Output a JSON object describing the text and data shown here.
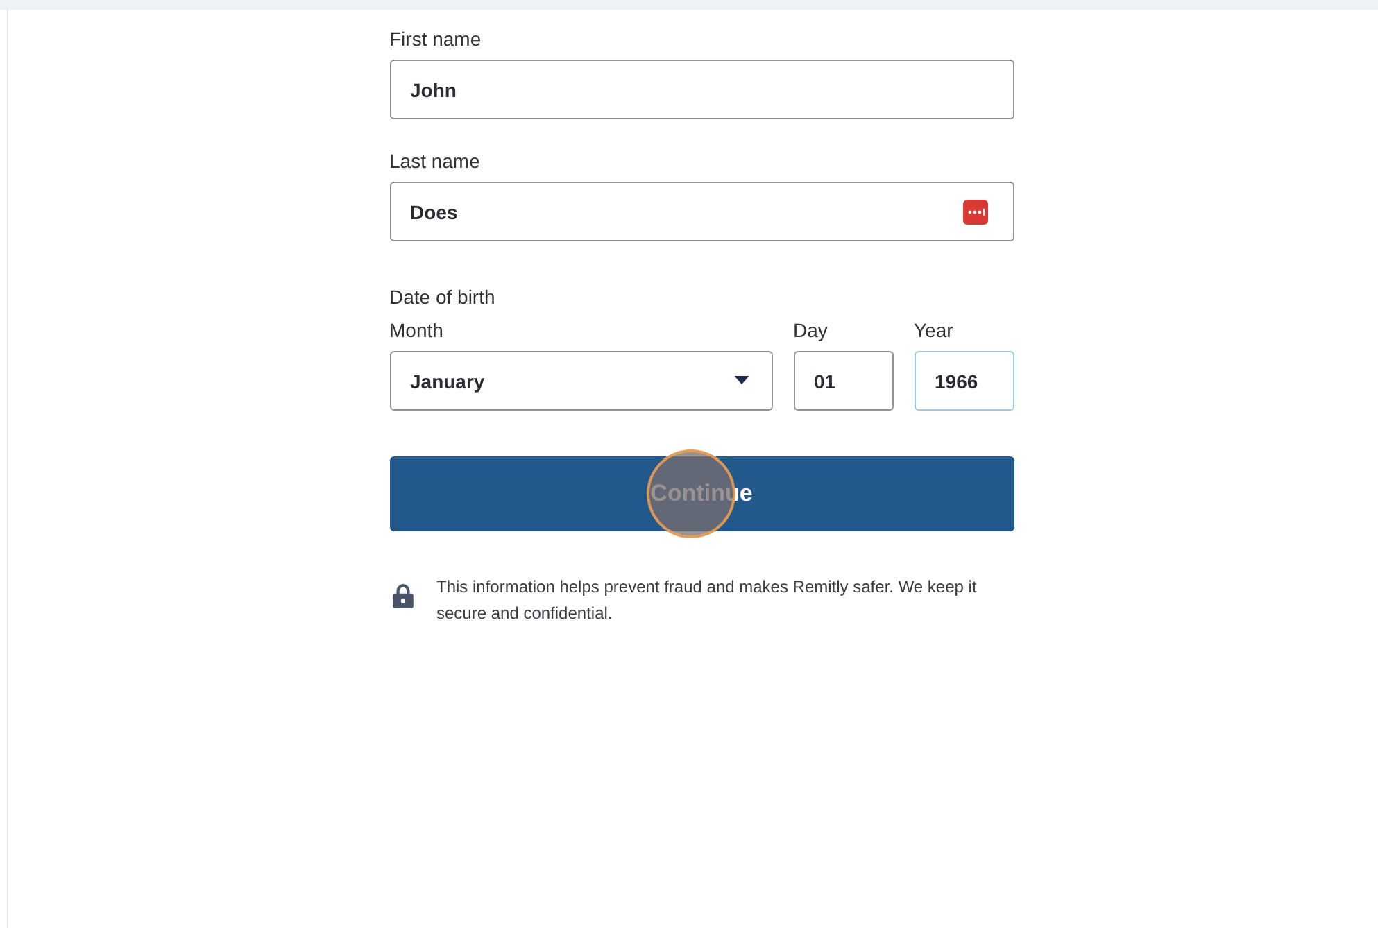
{
  "fields": [
    {
      "label": "First name",
      "value": "John",
      "focused": false,
      "password_manager_icon": false
    },
    {
      "label": "Last name",
      "value": "Does",
      "focused": false,
      "password_manager_icon": true
    }
  ],
  "date_of_birth": {
    "label": "Date of birth",
    "month": {
      "label": "Month",
      "value": "January",
      "focused": false
    },
    "day": {
      "label": "Day",
      "value": "01",
      "focused": false
    },
    "year": {
      "label": "Year",
      "value": "1966",
      "focused": true
    }
  },
  "continue_button": {
    "label": "Continue",
    "click_marker": true
  },
  "security_note": "This information helps prevent fraud and makes Remitly safer. We keep it secure and confidential."
}
